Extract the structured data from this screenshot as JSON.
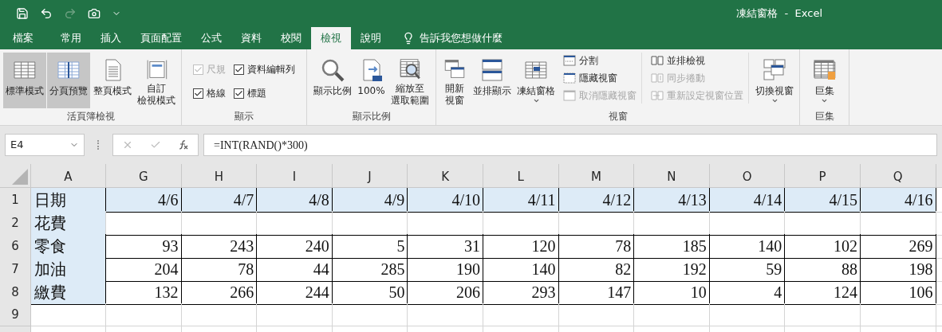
{
  "quick_access": [
    {
      "kind": "save",
      "disabled": false
    },
    {
      "kind": "undo",
      "disabled": false
    },
    {
      "kind": "redo",
      "disabled": true
    },
    {
      "kind": "camera",
      "disabled": false
    },
    {
      "kind": "customize",
      "disabled": false
    }
  ],
  "window": {
    "title": "凍結窗格  -  Excel"
  },
  "tabs": [
    {
      "label": "檔案",
      "selected": false
    },
    {
      "label": "常用",
      "selected": false
    },
    {
      "label": "插入",
      "selected": false
    },
    {
      "label": "頁面配置",
      "selected": false
    },
    {
      "label": "公式",
      "selected": false
    },
    {
      "label": "資料",
      "selected": false
    },
    {
      "label": "校閱",
      "selected": false
    },
    {
      "label": "檢視",
      "selected": true
    },
    {
      "label": "說明",
      "selected": false
    }
  ],
  "tell_me": {
    "placeholder": "告訴我您想做什麼"
  },
  "ribbon_groups": [
    {
      "label": "活頁簿檢視",
      "items": [
        {
          "kind": "large",
          "lines": [
            "標準模式"
          ],
          "highlighted": true
        },
        {
          "kind": "large",
          "lines": [
            "分頁預覽"
          ],
          "highlighted": true
        },
        {
          "kind": "large",
          "lines": [
            "整頁模式"
          ],
          "highlighted": false
        },
        {
          "kind": "large",
          "lines": [
            "自訂",
            "檢視模式"
          ],
          "highlighted": false
        }
      ]
    },
    {
      "label": "顯示",
      "items": [
        {
          "kind": "checkboxes",
          "checkboxes": [
            {
              "label": "尺規",
              "checked": true,
              "disabled": true
            },
            {
              "label": "資料編輯列",
              "checked": true,
              "disabled": false
            },
            {
              "label": "格線",
              "checked": true,
              "disabled": false
            },
            {
              "label": "標題",
              "checked": true,
              "disabled": false
            }
          ]
        }
      ]
    },
    {
      "label": "顯示比例",
      "items": [
        {
          "kind": "large",
          "lines": [
            "顯示比例"
          ],
          "highlighted": false
        },
        {
          "kind": "large",
          "lines": [
            "100%"
          ],
          "highlighted": false
        },
        {
          "kind": "large",
          "lines": [
            "縮放至",
            "選取範圍"
          ],
          "highlighted": false
        }
      ]
    },
    {
      "label": "視窗",
      "items": [
        {
          "kind": "large",
          "lines": [
            "開新",
            "視窗"
          ],
          "highlighted": false
        },
        {
          "kind": "large",
          "lines": [
            "並排顯示"
          ],
          "highlighted": false
        },
        {
          "kind": "large",
          "lines": [
            "凍結窗格"
          ],
          "highlighted": false,
          "dropdown": true
        },
        {
          "kind": "small",
          "buttons": [
            {
              "label": "分割",
              "disabled": false
            },
            {
              "label": "隱藏視窗",
              "disabled": false
            },
            {
              "label": "取消隱藏視窗",
              "disabled": true
            }
          ]
        },
        {
          "kind": "small",
          "buttons": [
            {
              "label": "並排檢視",
              "disabled": false
            },
            {
              "label": "同步捲動",
              "disabled": true
            },
            {
              "label": "重新設定視窗位置",
              "disabled": true
            }
          ]
        },
        {
          "kind": "large",
          "lines": [
            "切換視窗"
          ],
          "highlighted": false,
          "dropdown": true
        }
      ]
    },
    {
      "label": "巨集",
      "items": [
        {
          "kind": "large",
          "lines": [
            "巨集"
          ],
          "highlighted": false,
          "dropdown": true
        }
      ]
    }
  ],
  "formula_bar": {
    "name_box": "E4",
    "formula": "=INT(RAND()*300)"
  },
  "sheet": {
    "corner_column": "A",
    "columns": [
      "G",
      "H",
      "I",
      "J",
      "K",
      "L",
      "M",
      "N",
      "O",
      "P",
      "Q"
    ],
    "rows": [
      {
        "header": "1",
        "kind": "header",
        "label": "日期",
        "cells": [
          "4/6",
          "4/7",
          "4/8",
          "4/9",
          "4/10",
          "4/11",
          "4/12",
          "4/13",
          "4/14",
          "4/15",
          "4/16"
        ]
      },
      {
        "header": "2",
        "kind": "blank",
        "label": "花費",
        "cells": []
      },
      {
        "header": "6",
        "kind": "data",
        "label": "零食",
        "cells": [
          "93",
          "243",
          "240",
          "5",
          "31",
          "120",
          "78",
          "185",
          "140",
          "102",
          "269"
        ]
      },
      {
        "header": "7",
        "kind": "data",
        "label": "加油",
        "cells": [
          "204",
          "78",
          "44",
          "285",
          "190",
          "140",
          "82",
          "192",
          "59",
          "88",
          "198"
        ]
      },
      {
        "header": "8",
        "kind": "data",
        "label": "繳費",
        "cells": [
          "132",
          "266",
          "244",
          "50",
          "206",
          "293",
          "147",
          "10",
          "4",
          "124",
          "106"
        ]
      },
      {
        "header": "9",
        "kind": "empty",
        "label": "",
        "cells": []
      }
    ]
  }
}
